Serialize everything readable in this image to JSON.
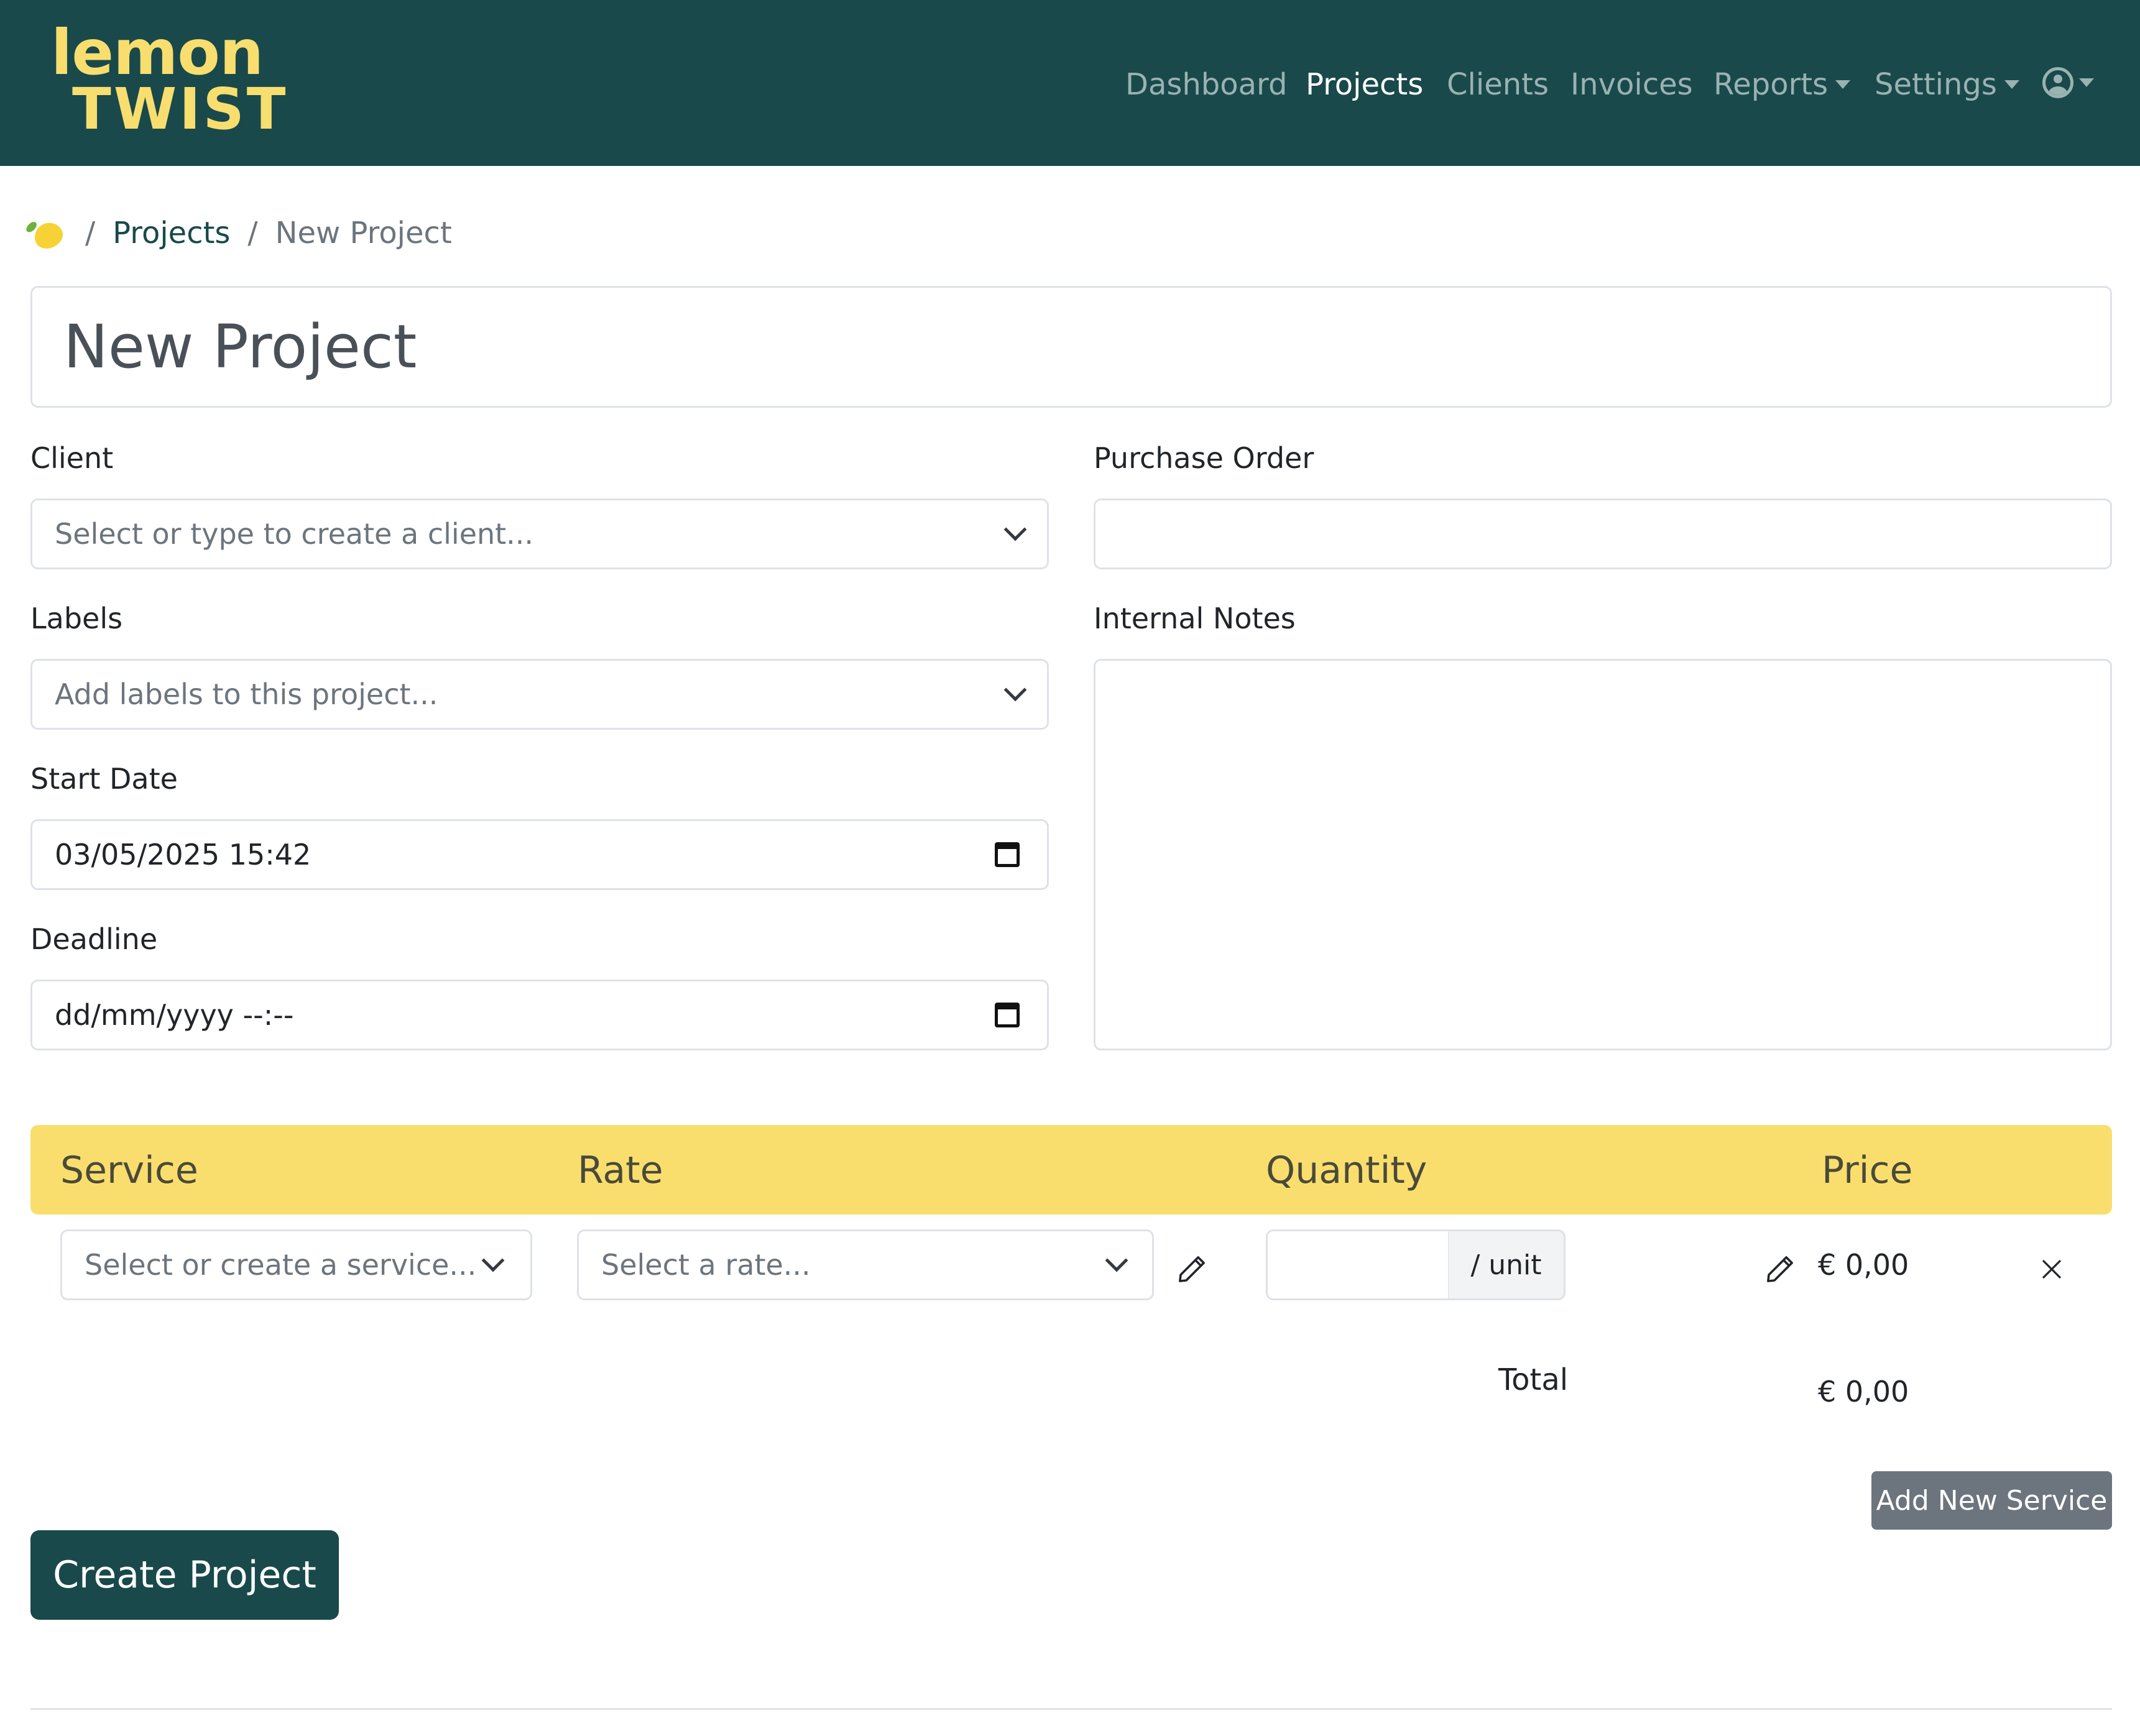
{
  "brand": {
    "line1": "lemon",
    "line2": "TWIST",
    "color": "#f7de6e"
  },
  "nav": {
    "items": [
      {
        "label": "Dashboard"
      },
      {
        "label": "Projects",
        "active": true
      },
      {
        "label": "Clients"
      },
      {
        "label": "Invoices"
      },
      {
        "label": "Reports",
        "dropdown": true
      },
      {
        "label": "Settings",
        "dropdown": true
      }
    ],
    "user_icon": "user-circle-icon"
  },
  "breadcrumb": {
    "home_icon": "lemon-icon",
    "sep": "/",
    "link": "Projects",
    "current": "New Project"
  },
  "form": {
    "title_value": "New Project",
    "client": {
      "label": "Client",
      "placeholder": "Select or type to create a client..."
    },
    "purchase_order": {
      "label": "Purchase Order",
      "value": ""
    },
    "labels": {
      "label": "Labels",
      "placeholder": "Add labels to this project..."
    },
    "internal_notes": {
      "label": "Internal Notes",
      "value": ""
    },
    "start_date": {
      "label": "Start Date",
      "value": "03/05/2025 15:42"
    },
    "deadline": {
      "label": "Deadline",
      "value": "dd/mm/yyyy --:--"
    }
  },
  "services": {
    "headers": {
      "service": "Service",
      "rate": "Rate",
      "quantity": "Quantity",
      "price": "Price"
    },
    "row": {
      "service_placeholder": "Select or create a service...",
      "rate_placeholder": "Select a rate...",
      "unit": "/ unit",
      "price": "€ 0,00"
    },
    "total_label": "Total",
    "total_value": "€ 0,00",
    "add_button": "Add New Service"
  },
  "submit_button": "Create Project",
  "colors": {
    "primary": "#19494b",
    "accent": "#f9de6e",
    "secondary": "#6c757d"
  }
}
